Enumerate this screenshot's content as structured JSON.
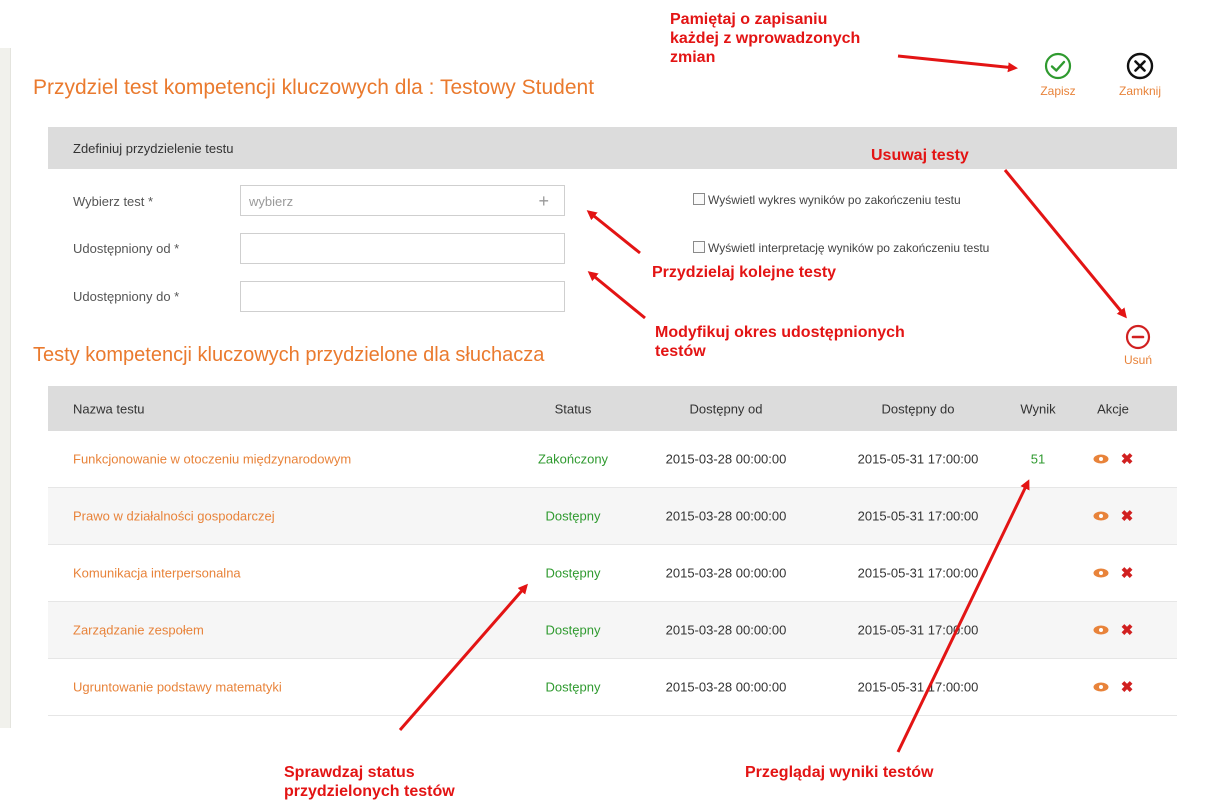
{
  "header": {
    "title": "Przydziel test kompetencji kluczowych dla : Testowy Student",
    "save_label": "Zapisz",
    "close_label": "Zamknij"
  },
  "form": {
    "section_title": "Zdefiniuj przydzielenie testu",
    "test_label": "Wybierz test *",
    "test_placeholder": "wybierz",
    "from_label": "Udostępniony od *",
    "from_value": "",
    "to_label": "Udostępniony do *",
    "to_value": "",
    "checkbox_chart": "Wyświetl wykres wyników po zakończeniu testu",
    "checkbox_interpretation": "Wyświetl interpretację wyników po zakończeniu testu"
  },
  "assigned": {
    "title": "Testy kompetencji kluczowych przydzielone dla słuchacza",
    "remove_label": "Usuń",
    "columns": {
      "name": "Nazwa testu",
      "status": "Status",
      "from": "Dostępny od",
      "to": "Dostępny do",
      "score": "Wynik",
      "actions": "Akcje"
    },
    "rows": [
      {
        "name": "Funkcjonowanie w otoczeniu międzynarodowym",
        "status": "Zakończony",
        "from": "2015-03-28 00:00:00",
        "to": "2015-05-31 17:00:00",
        "score": "51"
      },
      {
        "name": "Prawo w działalności gospodarczej",
        "status": "Dostępny",
        "from": "2015-03-28 00:00:00",
        "to": "2015-05-31 17:00:00",
        "score": ""
      },
      {
        "name": "Komunikacja interpersonalna",
        "status": "Dostępny",
        "from": "2015-03-28 00:00:00",
        "to": "2015-05-31 17:00:00",
        "score": ""
      },
      {
        "name": "Zarządzanie zespołem",
        "status": "Dostępny",
        "from": "2015-03-28 00:00:00",
        "to": "2015-05-31 17:00:00",
        "score": ""
      },
      {
        "name": "Ugruntowanie podstawy matematyki",
        "status": "Dostępny",
        "from": "2015-03-28 00:00:00",
        "to": "2015-05-31 17:00:00",
        "score": ""
      }
    ]
  },
  "annotations": {
    "save_note_1": "Pamiętaj o zapisaniu",
    "save_note_2": "każdej z wprowadzonych",
    "save_note_3": "zmian",
    "remove_note": "Usuwaj testy",
    "assign_note": "Przydzielaj kolejne testy",
    "modify_note_1": "Modyfikuj okres udostępnionych",
    "modify_note_2": "testów",
    "status_note_1": "Sprawdzaj status",
    "status_note_2": "przydzielonych testów",
    "results_note": "Przeglądaj wyniki testów"
  },
  "colors": {
    "accent": "#ea7a2e",
    "status_green": "#2f9a2f",
    "annotation_red": "#e31414",
    "header_gray": "#dcdcdc"
  },
  "icons": [
    "check-circle-icon",
    "close-circle-icon",
    "minus-circle-icon",
    "plus-icon",
    "eye-icon",
    "delete-x-icon"
  ]
}
